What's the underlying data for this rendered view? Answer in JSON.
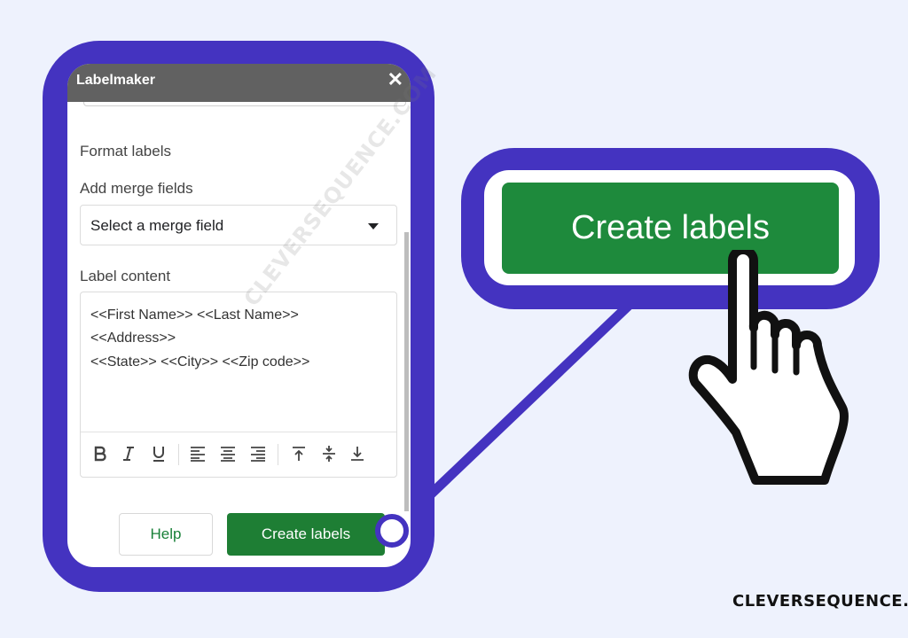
{
  "dialog": {
    "title": "Labelmaker",
    "close_glyph": "✕",
    "format_label": "Format labels",
    "merge_label": "Add merge fields",
    "merge_select_value": "Select a merge field",
    "content_label": "Label content",
    "content_lines": [
      "<<First Name>> <<Last Name>>",
      "<<Address>>",
      "<<State>> <<City>> <<Zip code>>"
    ],
    "toolbar_icons": [
      "bold-icon",
      "italic-icon",
      "underline-icon",
      "align-left-icon",
      "align-center-icon",
      "align-right-icon",
      "align-top-icon",
      "align-middle-icon",
      "align-bottom-icon"
    ],
    "help_button": "Help",
    "create_button": "Create labels"
  },
  "callout": {
    "button_label": "Create labels"
  },
  "watermark": "CLEVERSEQUENCE.COM",
  "footer": "CLEVERSEQUENCE.COM",
  "colors": {
    "frame": "#4433c0",
    "background": "#eef2fd",
    "titlebar": "#616161",
    "button_green": "#1e7e34",
    "help_text": "#188038"
  }
}
